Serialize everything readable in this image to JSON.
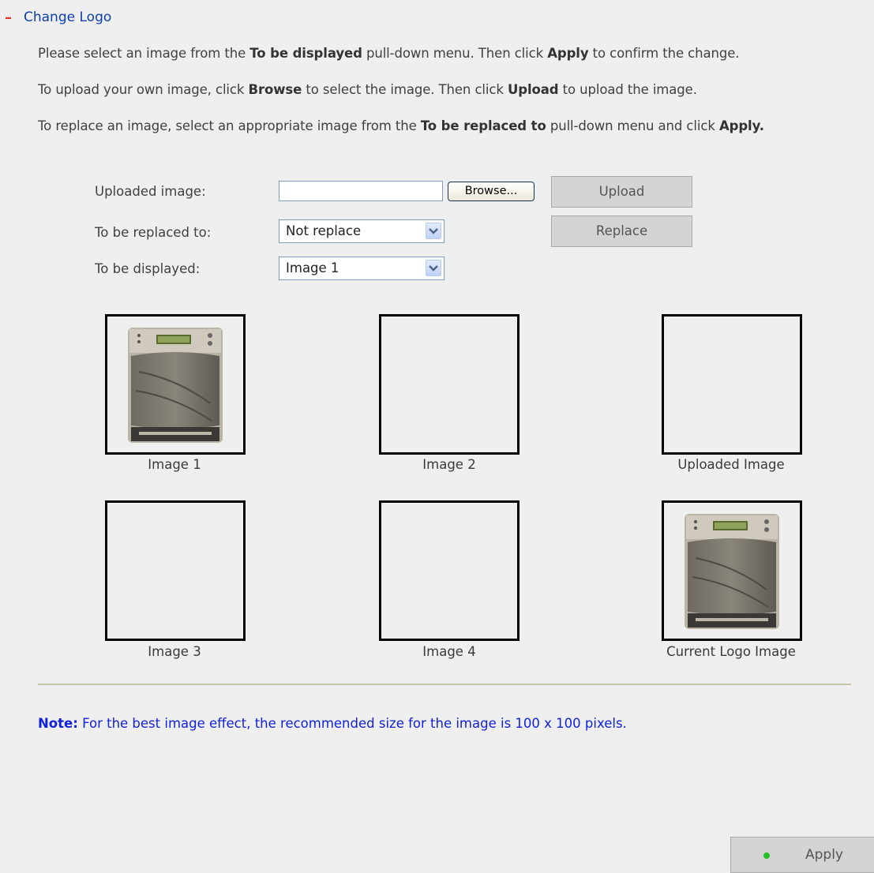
{
  "section": {
    "toggle": "–",
    "title": "Change Logo"
  },
  "instructions": {
    "line1": {
      "a": "Please select an image from the ",
      "b": "To be displayed",
      "c": " pull-down menu. Then click ",
      "d": "Apply",
      "e": " to confirm the change."
    },
    "line2": {
      "a": "To upload your own image, click ",
      "b": "Browse",
      "c": " to select the image. Then click ",
      "d": "Upload",
      "e": " to upload the image."
    },
    "line3": {
      "a": "To replace an image, select an appropriate image from the ",
      "b": "To be replaced to",
      "c": " pull-down menu and click ",
      "d": "Apply."
    }
  },
  "form": {
    "uploaded_image_label": "Uploaded image:",
    "uploaded_image_value": "",
    "browse_label": "Browse...",
    "upload_label": "Upload",
    "replaced_to_label": "To be replaced to:",
    "replaced_to_value": "Not replace",
    "replace_label": "Replace",
    "displayed_label": "To be displayed:",
    "displayed_value": "Image 1"
  },
  "images": {
    "image1": "Image 1",
    "image2": "Image 2",
    "uploaded": "Uploaded Image",
    "image3": "Image 3",
    "image4": "Image 4",
    "current": "Current Logo Image"
  },
  "note": {
    "label": "Note:",
    "text": " For the best image effect, the recommended size for the image is 100 x 100 pixels."
  },
  "apply_button": {
    "label": "Apply"
  },
  "colors": {
    "header_text": "#0b3fb0",
    "toggle": "#e0342c",
    "note_text": "#1122dd",
    "button_bg": "#d4d4d4",
    "apply_dot": "#22c022"
  }
}
